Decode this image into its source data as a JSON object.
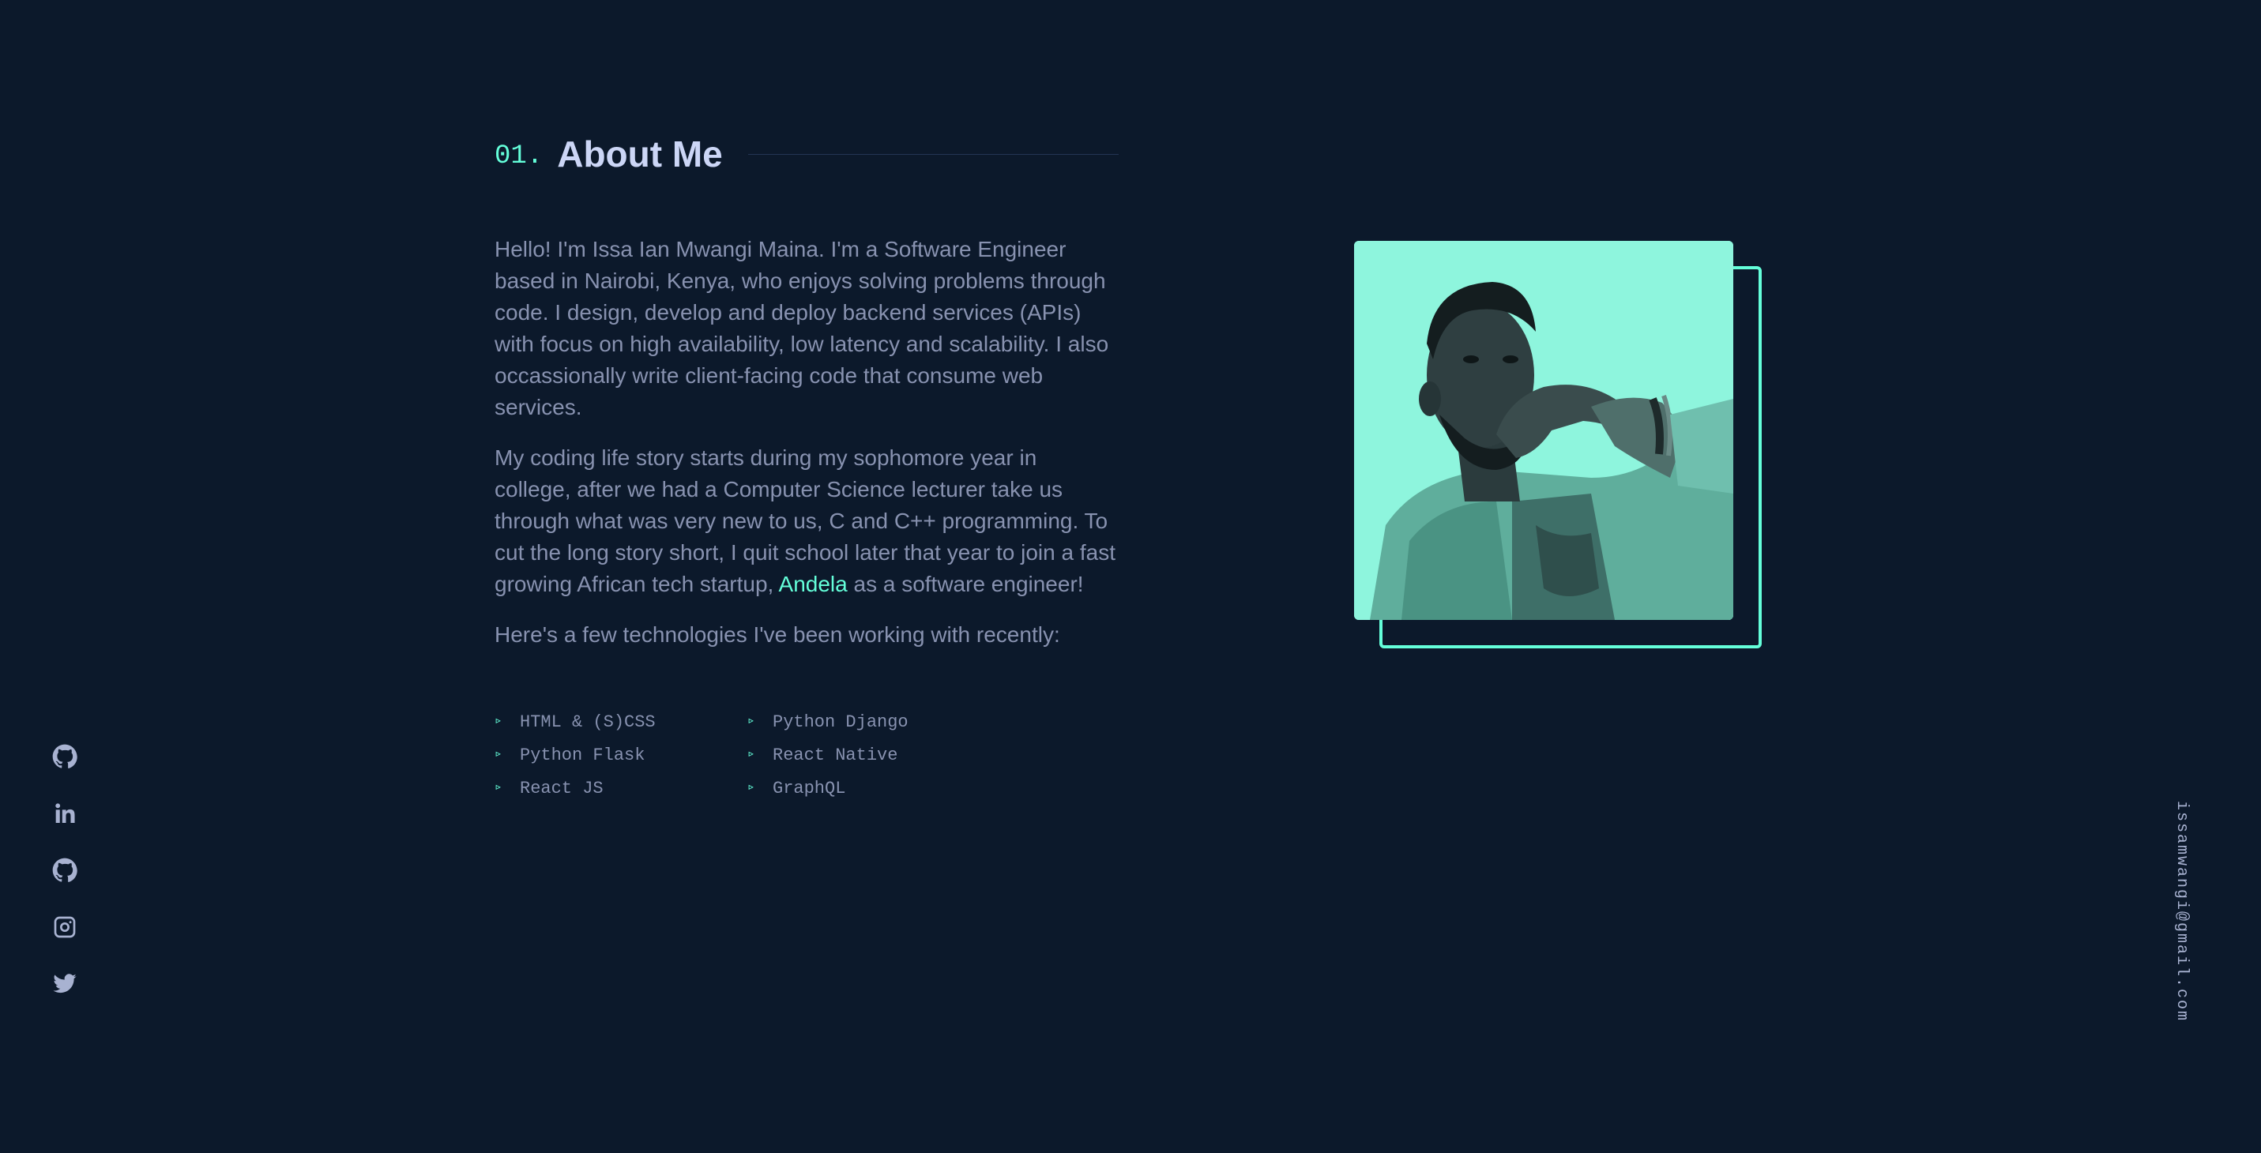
{
  "section": {
    "number": "01.",
    "title": "About Me"
  },
  "bio": {
    "p1": "Hello! I'm Issa Ian Mwangi Maina. I'm a Software Engineer based in Nairobi, Kenya, who enjoys solving problems through code. I design, develop and deploy backend services (APIs) with focus on high availability, low latency and scalability. I also occassionally write client-facing code that consume web services.",
    "p2_before": "My coding life story starts during my sophomore year in college, after we had a Computer Science lecturer take us through what was very new to us, C and C++ programming. To cut the long story short, I quit school later that year to join a fast growing African tech startup, ",
    "p2_link": "Andela",
    "p2_after": " as a software engineer!",
    "p3": "Here's a few technologies I've been working with recently:"
  },
  "technologies": [
    "HTML & (S)CSS",
    "Python Django",
    "Python Flask",
    "React Native",
    "React JS",
    "GraphQL"
  ],
  "social": {
    "icons": [
      "github-icon",
      "linkedin-icon",
      "github-icon",
      "instagram-icon",
      "twitter-icon"
    ]
  },
  "email": "issamwangi@gmail.com",
  "colors": {
    "background": "#0c192b",
    "accent": "#64ffda",
    "heading": "#ccd6f6",
    "text": "#8892b0",
    "portrait_tint": "#8ef5dd"
  }
}
